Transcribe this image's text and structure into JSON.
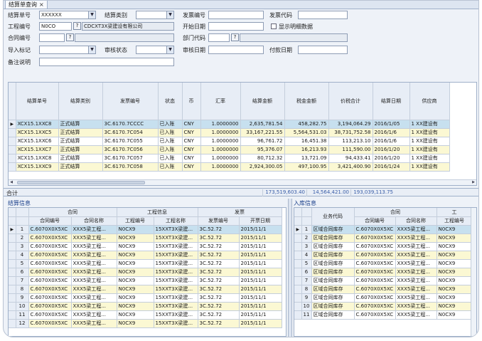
{
  "tab": {
    "title": "结算单查询",
    "close": "×"
  },
  "form": {
    "labels": {
      "settle_no": "结算单号",
      "payee": "结算类别",
      "invoice_no": "发票编号",
      "invoice_code": "发票代码",
      "company_code": "工程编号",
      "start_date": "开始日期",
      "show_detail": "显示明细数据",
      "contract_no": "合同编号",
      "dept_code": "部门代码",
      "import_flag": "导入标记",
      "audit_status": "审核状态",
      "audit_date": "审核日期",
      "pay_date": "付款日期",
      "remark": "备注说明"
    },
    "values": {
      "settle_no": "XXXXXX",
      "company_code": "N0CO",
      "company_name": "CDCXT3X梁建设有限公司",
      "q": "?"
    }
  },
  "main_table": {
    "headers": [
      "结算单号",
      "结算类别",
      "发票编号",
      "状态",
      "币",
      "汇率",
      "结算金额",
      "税金金额",
      "价税合计",
      "结算日期",
      "供应商"
    ],
    "rows": [
      {
        "ind": "▶",
        "cells": [
          "XCX15.1XXC8",
          "正式结算",
          "3C.6170.7CCCC",
          "已入账",
          "CNY",
          "1.0000000",
          "2,635,781.54",
          "458,282.75",
          "3,194,064.29",
          "2016/1/05",
          "1 XX建设有"
        ],
        "cls": "sel"
      },
      {
        "ind": "",
        "cells": [
          "XCX15.1XXC5",
          "正式结算",
          "3C.6170.7C054",
          "已入账",
          "CNY",
          "1.0000000",
          "33,167,221.55",
          "5,564,531.03",
          "38,731,752.58",
          "2016/1/6",
          "1 XX建设有"
        ],
        "cls": "yel"
      },
      {
        "ind": "",
        "cells": [
          "XCX15.1XXC6",
          "正式结算",
          "3C.6170.7C055",
          "已入账",
          "CNY",
          "1.0000000",
          "96,761.72",
          "16,451.38",
          "113,213.10",
          "2016/1/6",
          "1 XX建设有"
        ],
        "cls": "wht"
      },
      {
        "ind": "",
        "cells": [
          "XCX15.1XXC7",
          "正式结算",
          "3C.6170.7C056",
          "已入账",
          "CNY",
          "1.0000000",
          "95,376.07",
          "16,213.93",
          "111,590.00",
          "2016/1/20",
          "1 XX建设有"
        ],
        "cls": "yel"
      },
      {
        "ind": "",
        "cells": [
          "XCX15.1XXC8",
          "正式结算",
          "3C.6170.7C057",
          "已入账",
          "CNY",
          "1.0000000",
          "80,712.32",
          "13,721.09",
          "94,433.41",
          "2016/1/20",
          "1 XX建设有"
        ],
        "cls": "wht"
      },
      {
        "ind": "",
        "cells": [
          "XCX15.1XXC9",
          "正式结算",
          "3C.6170.7C058",
          "已入账",
          "CNY",
          "1.0000000",
          "2,924,300.05",
          "497,100.95",
          "3,421,400.90",
          "2016/1/24",
          "1 XX建设有"
        ],
        "cls": "yel"
      }
    ]
  },
  "summary": {
    "label": "合计",
    "total_amount": "173,519,603.40",
    "total_tax": "14,564,421.00",
    "total_sum": "193,039,113.75"
  },
  "left_section": {
    "title": "结算信息",
    "group_headers": [
      "合同",
      "工程信息",
      "发票"
    ],
    "headers": [
      "合同编号",
      "合同名称",
      "工程编号",
      "工程名称",
      "发票编号",
      "开票日期"
    ],
    "rows": [
      [
        "C.6070X0X5XC",
        "XXX5梁工程...",
        "N0CX9",
        "15XXT3X梁建...",
        "3C.52.72",
        "2015/11/1"
      ],
      [
        "C.6070X0X5XC",
        "XXX5梁工程...",
        "N0CX9",
        "15XXT3X梁建...",
        "3C.52.72",
        "2015/11/1"
      ],
      [
        "C.6070X0X5XC",
        "XXX5梁工程...",
        "N0CX9",
        "15XXT3X梁建...",
        "3C.52.72",
        "2015/11/1"
      ],
      [
        "C.6070X0X5XC",
        "XXX5梁工程...",
        "N0CX9",
        "15XXT3X梁建...",
        "3C.52.72",
        "2015/11/1"
      ],
      [
        "C.6070X0X5XC",
        "XXX5梁工程...",
        "N0CX9",
        "15XXT3X梁建...",
        "3C.52.72",
        "2015/11/1"
      ],
      [
        "C.6070X0X5XC",
        "XXX5梁工程...",
        "N0CX9",
        "15XXT3X梁建...",
        "3C.52.72",
        "2015/11/1"
      ],
      [
        "C.6070X0X5XC",
        "XXX5梁工程...",
        "N0CX9",
        "15XXT3X梁建...",
        "3C.52.72",
        "2015/11/1"
      ],
      [
        "C.6070X0X5XC",
        "XXX5梁工程...",
        "N0CX9",
        "15XXT3X梁建...",
        "3C.52.72",
        "2015/11/1"
      ],
      [
        "C.6070X0X5XC",
        "XXX5梁工程...",
        "N0CX9",
        "15XXT3X梁建...",
        "3C.52.72",
        "2015/11/1"
      ],
      [
        "C.6070X0X5XC",
        "XXX5梁工程...",
        "N0CX9",
        "15XXT3X梁建...",
        "3C.52.72",
        "2015/11/1"
      ],
      [
        "C.6070X0X5XC",
        "XXX5梁工程...",
        "N0CX9",
        "15XXT3X梁建...",
        "3C.52.72",
        "2015/11/1"
      ],
      [
        "C.6070X0X5XC",
        "XXX5梁工程...",
        "N0CX9",
        "15XXT3X梁建...",
        "3C.52.72",
        "2015/11/1"
      ]
    ]
  },
  "right_section": {
    "title": "入库信息",
    "group_headers": [
      "业务代码",
      "合同",
      "工"
    ],
    "headers": [
      "合同编号",
      "合同名称",
      "工程编号"
    ],
    "rows": [
      [
        "区域合同库存",
        "C.6070X0X5XC",
        "XXX5梁工程...",
        "N0CX9"
      ],
      [
        "区域合同库存",
        "C.6070X0X5XC",
        "XXX5梁工程...",
        "N0CX9"
      ],
      [
        "区域合同库存",
        "C.6070X0X5XC",
        "XXX5梁工程...",
        "N0CX9"
      ],
      [
        "区域合同库存",
        "C.6070X0X5XC",
        "XXX5梁工程...",
        "N0CX9"
      ],
      [
        "区域合同库存",
        "C.6070X0X5XC",
        "XXX5梁工程...",
        "N0CX9"
      ],
      [
        "区域合同库存",
        "C.6070X0X5XC",
        "XXX5梁工程...",
        "N0CX9"
      ],
      [
        "区域合同库存",
        "C.6070X0X5XC",
        "XXX5梁工程...",
        "N0CX9"
      ],
      [
        "区域合同库存",
        "C.6070X0X5XC",
        "XXX5梁工程...",
        "N0CX9"
      ],
      [
        "区域合同库存",
        "C.6070X0X5XC",
        "XXX5梁工程...",
        "N0CX9"
      ],
      [
        "区域合同库存",
        "C.6070X0X5XC",
        "XXX5梁工程...",
        "N0CX9"
      ],
      [
        "区域合同库存",
        "C.6070X0X5XC",
        "XXX5梁工程...",
        "N0CX9"
      ]
    ]
  },
  "colors": {
    "selected_row": "#c7e0ef",
    "alt_row": "#fbf8d3",
    "header": "#e7edf6"
  }
}
